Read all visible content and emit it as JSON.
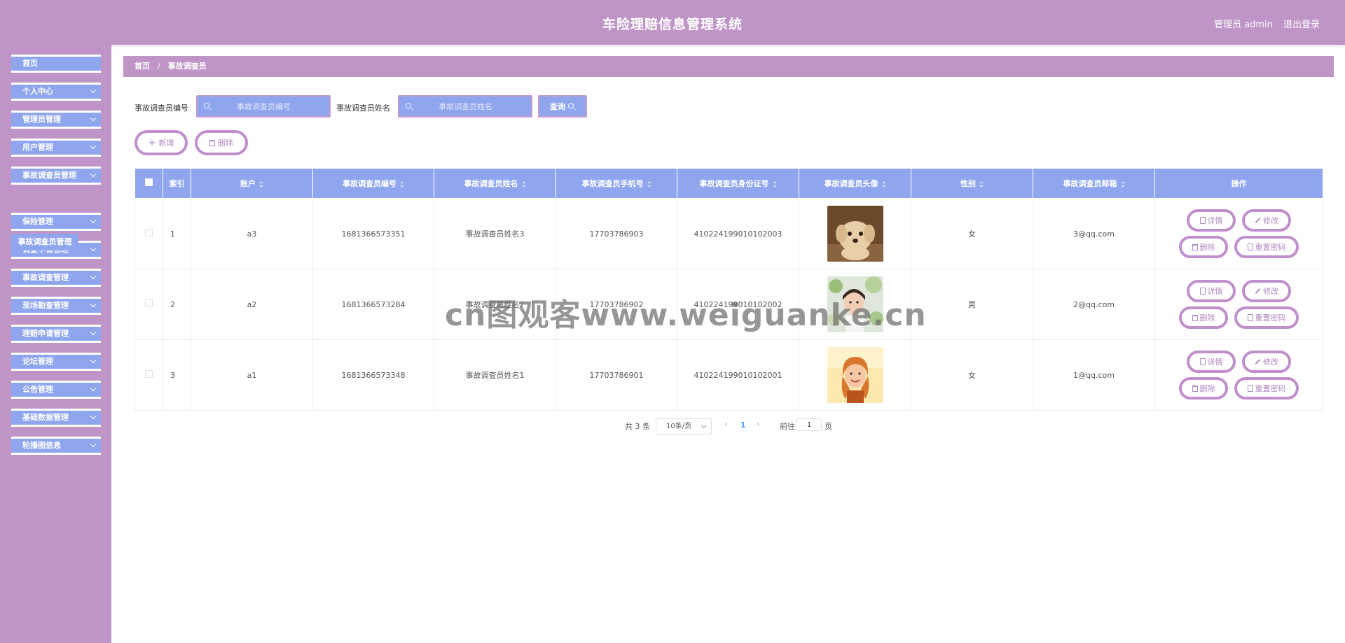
{
  "header": {
    "title": "车险理赔信息管理系统",
    "admin_label": "管理员 admin",
    "logout_label": "退出登录"
  },
  "sidebar": {
    "items": [
      {
        "label": "首页",
        "has_chevron": false
      },
      {
        "label": "个人中心",
        "has_chevron": true
      },
      {
        "label": "管理员管理",
        "has_chevron": true
      },
      {
        "label": "用户管理",
        "has_chevron": true
      },
      {
        "label": "事故调查员管理",
        "has_chevron": true
      },
      {
        "label": "保险管理",
        "has_chevron": true
      },
      {
        "label": "调查申请管理",
        "has_chevron": true
      },
      {
        "label": "事故调查管理",
        "has_chevron": true
      },
      {
        "label": "现场勘查管理",
        "has_chevron": true
      },
      {
        "label": "理赔申请管理",
        "has_chevron": true
      },
      {
        "label": "论坛管理",
        "has_chevron": true
      },
      {
        "label": "公告管理",
        "has_chevron": true
      },
      {
        "label": "基础数据管理",
        "has_chevron": true
      },
      {
        "label": "轮播图信息",
        "has_chevron": true
      }
    ],
    "active_sub_item": "事故调查员管理"
  },
  "breadcrumb": {
    "home": "首页",
    "separator": "/",
    "current": "事故调查员"
  },
  "search": {
    "field1_label": "事故调查员编号",
    "field1_placeholder": "事故调查员编号",
    "field2_label": "事故调查员姓名",
    "field2_placeholder": "事故调查员姓名",
    "query_label": "查询"
  },
  "actions": {
    "add_label": "新增",
    "delete_label": "删除"
  },
  "table": {
    "columns": [
      "索引",
      "账户",
      "事故调查员编号",
      "事故调查员姓名",
      "事故调查员手机号",
      "事故调查员身份证号",
      "事故调查员头像",
      "性别",
      "事故调查员邮箱",
      "操作"
    ],
    "rows": [
      {
        "index": "1",
        "account": "a3",
        "code": "1681366573351",
        "name": "事故调查员姓名3",
        "phone": "17703786903",
        "id_card": "410224199010102003",
        "avatar": "puppy",
        "gender": "女",
        "email": "3@qq.com"
      },
      {
        "index": "2",
        "account": "a2",
        "code": "1681366573284",
        "name": "事故调查员姓名2",
        "phone": "17703786902",
        "id_card": "410224199010102002",
        "avatar": "woman-leaves",
        "gender": "男",
        "email": "2@qq.com"
      },
      {
        "index": "3",
        "account": "a1",
        "code": "1681366573348",
        "name": "事故调查员姓名1",
        "phone": "17703786901",
        "id_card": "410224199010102001",
        "avatar": "woman-smiling",
        "gender": "女",
        "email": "1@qq.com"
      }
    ],
    "row_actions": {
      "detail": "详情",
      "edit": "修改",
      "delete": "删除",
      "reset_password": "重置密码"
    }
  },
  "pagination": {
    "total": "共 3 条",
    "page_size": "10条/页",
    "current_page": "1",
    "goto_label": "前往",
    "goto_value": "1",
    "unit": "页"
  },
  "watermark": "cn图观客www.weiguanke.cn",
  "colors": {
    "header_bg": "#bf95c8",
    "accent_blue": "#8fa6ee",
    "button_border": "#c08fcc",
    "button_text": "#b08ac0"
  }
}
